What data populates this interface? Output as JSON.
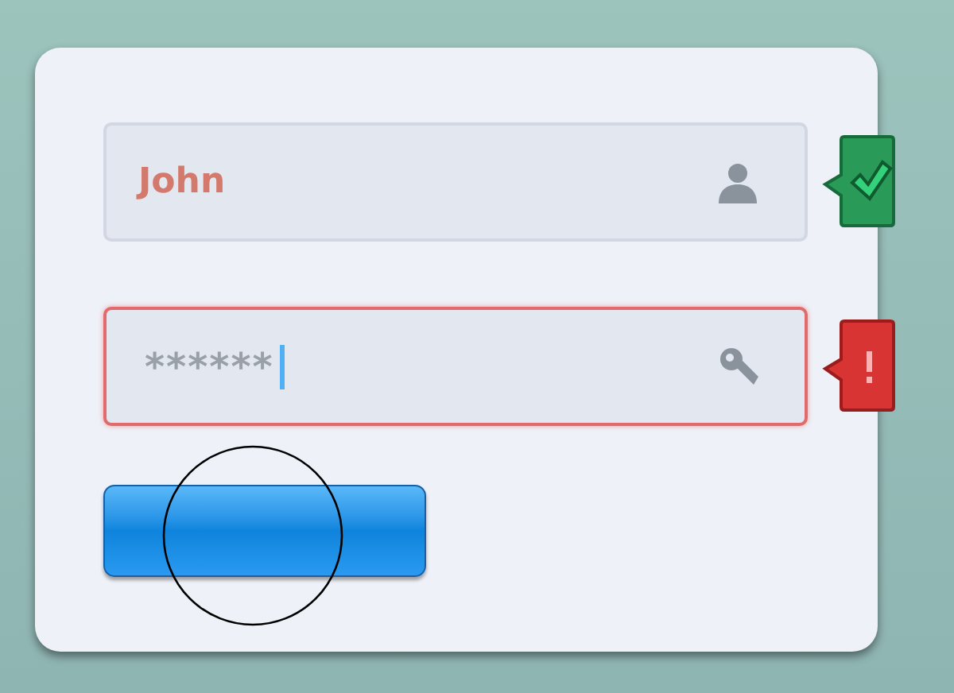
{
  "fields": [
    {
      "kind": "text",
      "value": "John",
      "valid": true,
      "focused": false
    },
    {
      "kind": "password",
      "value": "******",
      "valid": false,
      "focused": true
    }
  ],
  "submit_button": {
    "pressed_marker": true
  }
}
